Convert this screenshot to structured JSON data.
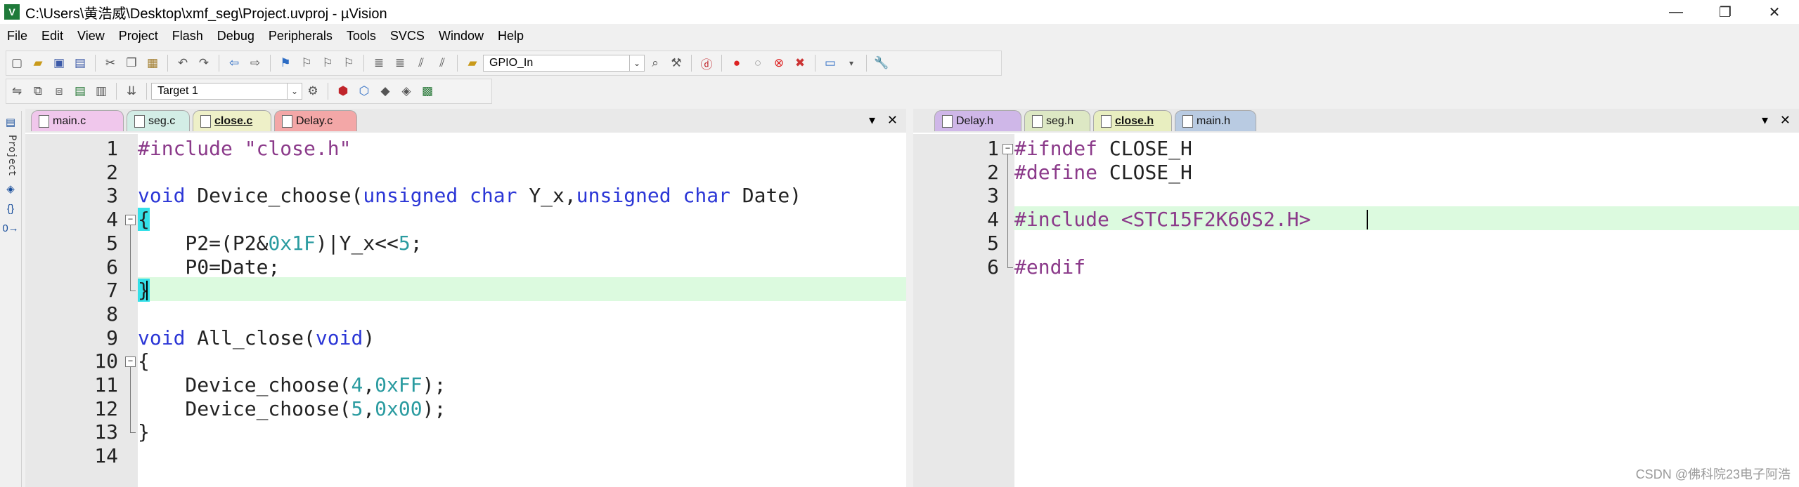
{
  "window": {
    "title": "C:\\Users\\黄浩威\\Desktop\\xmf_seg\\Project.uvproj - µVision",
    "app_icon": "keil-uvision-icon",
    "controls": [
      "—",
      "❐",
      "✕"
    ]
  },
  "menu": [
    "File",
    "Edit",
    "View",
    "Project",
    "Flash",
    "Debug",
    "Peripherals",
    "Tools",
    "SVCS",
    "Window",
    "Help"
  ],
  "toolbar": {
    "find_combo_value": "GPIO_In",
    "target_combo_value": "Target 1"
  },
  "left_strip": {
    "project_label": "Project"
  },
  "left_pane": {
    "tabs": [
      {
        "label": "main.c",
        "color": "#f0c7ec",
        "active": false
      },
      {
        "label": "seg.c",
        "color": "#d3ede6",
        "active": false
      },
      {
        "label": "close.c",
        "color": "#eef0c8",
        "active": true
      },
      {
        "label": "Delay.c",
        "color": "#f3a7a7",
        "active": false
      }
    ],
    "lines": [
      {
        "n": "1",
        "text": "#include \"close.h\""
      },
      {
        "n": "2",
        "text": ""
      },
      {
        "n": "3",
        "text": "void Device_choose(unsigned char Y_x,unsigned char Date)"
      },
      {
        "n": "4",
        "text": "{"
      },
      {
        "n": "5",
        "text": "    P2=(P2&0x1F)|Y_x<<5;"
      },
      {
        "n": "6",
        "text": "    P0=Date;"
      },
      {
        "n": "7",
        "text": "}"
      },
      {
        "n": "8",
        "text": ""
      },
      {
        "n": "9",
        "text": "void All_close(void)"
      },
      {
        "n": "10",
        "text": "{"
      },
      {
        "n": "11",
        "text": "    Device_choose(4,0xFF);"
      },
      {
        "n": "12",
        "text": "    Device_choose(5,0x00);"
      },
      {
        "n": "13",
        "text": "}"
      },
      {
        "n": "14",
        "text": ""
      }
    ]
  },
  "right_pane": {
    "tabs": [
      {
        "label": "Delay.h",
        "color": "#cfb7e8",
        "active": false
      },
      {
        "label": "seg.h",
        "color": "#dde8c4",
        "active": false
      },
      {
        "label": "close.h",
        "color": "#e8eec0",
        "active": true
      },
      {
        "label": "main.h",
        "color": "#b9cbe2",
        "active": false
      }
    ],
    "lines": [
      {
        "n": "1",
        "text": "#ifndef CLOSE_H"
      },
      {
        "n": "2",
        "text": "#define CLOSE_H"
      },
      {
        "n": "3",
        "text": ""
      },
      {
        "n": "4",
        "text": "#include <STC15F2K60S2.H>"
      },
      {
        "n": "5",
        "text": ""
      },
      {
        "n": "6",
        "text": "#endif"
      }
    ]
  },
  "watermark": "CSDN @佛科院23电子阿浩"
}
